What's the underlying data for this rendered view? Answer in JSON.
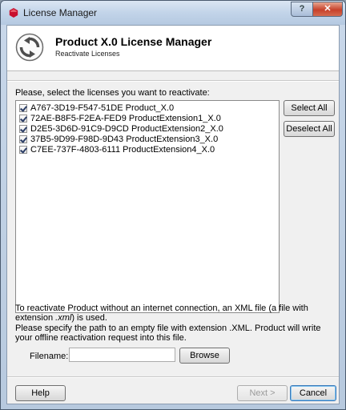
{
  "window": {
    "title": "License Manager"
  },
  "header": {
    "title": "Product X.0 License Manager",
    "subtitle": "Reactivate Licenses"
  },
  "prompt": "Please, select the licenses you want to reactivate:",
  "licenses": [
    {
      "key": "A767-3D19-F547-51DE",
      "product": "Product_X.0",
      "checked": true
    },
    {
      "key": "72AE-B8F5-F2EA-FED9",
      "product": "ProductExtension1_X.0",
      "checked": true
    },
    {
      "key": "D2E5-3D6D-91C9-D9CD",
      "product": "ProductExtension2_X.0",
      "checked": true
    },
    {
      "key": "37B5-9D99-F98D-9D43",
      "product": "ProductExtension3_X.0",
      "checked": true
    },
    {
      "key": "C7EE-737F-4803-6111",
      "product": "ProductExtension4_X.0",
      "checked": true
    }
  ],
  "buttons": {
    "select_all": "Select All",
    "deselect_all": "Deselect All",
    "browse": "Browse",
    "help": "Help",
    "next": "Next >",
    "cancel": "Cancel"
  },
  "info": {
    "line1a": "To reactivate Product without an internet connection, an XML file (a file with extension ",
    "line1_ext": ".xml",
    "line1b": ") is used.",
    "line2": "Please specify the path to an empty file with extension .XML. Product will write your offline reactivation request into this file."
  },
  "filename": {
    "label": "Filename:",
    "value": ""
  },
  "icons": {
    "app": "red-hexagon-icon",
    "logo": "refresh-circle-icon",
    "help": "help-icon",
    "close": "close-icon"
  },
  "colors": {
    "title_icon": "#c8102e",
    "default_button_border": "#3a78b8"
  }
}
